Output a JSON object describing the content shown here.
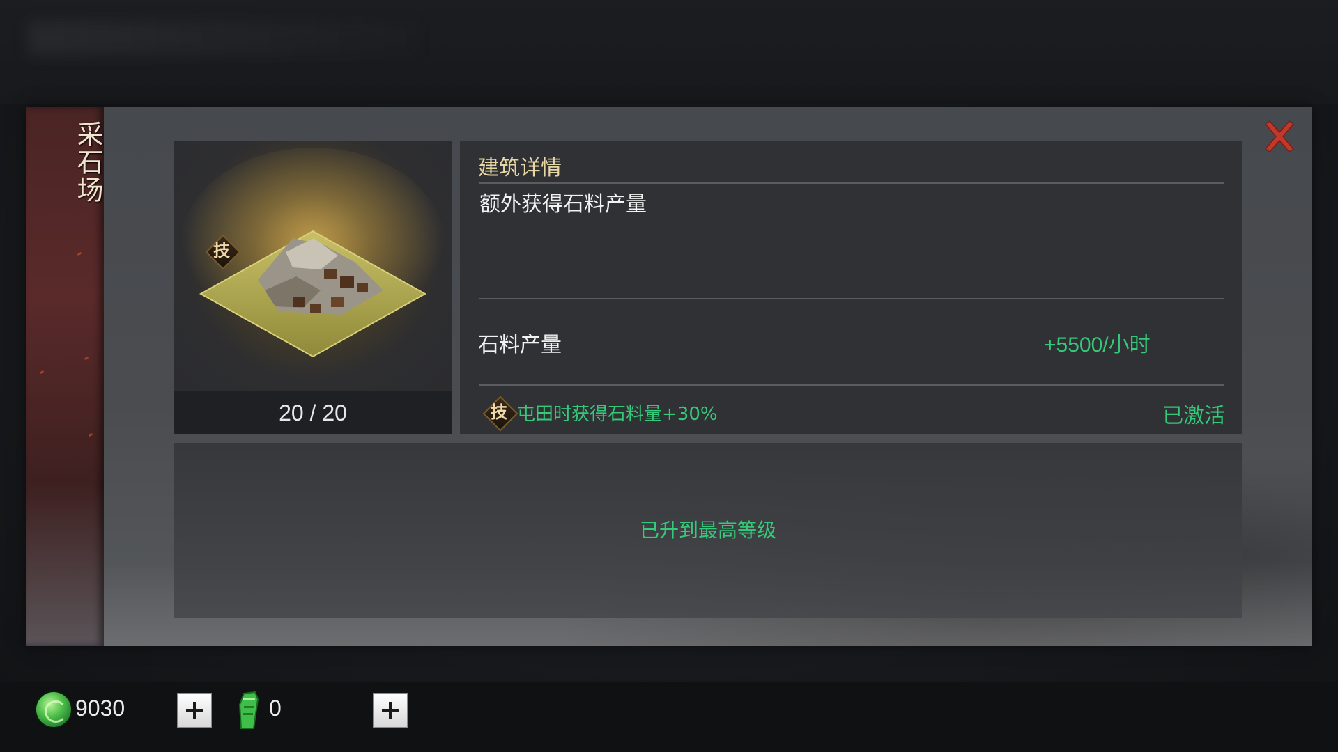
{
  "building": {
    "name": "采石场",
    "level_text": "20 / 20"
  },
  "detail": {
    "title": "建筑详情",
    "description": "额外获得石料产量",
    "stat_label": "石料产量",
    "stat_value": "+5500/小时",
    "tech_badge": "技",
    "tech_text": "屯田时获得石料量+30%",
    "tech_status": "已激活"
  },
  "upgrade": {
    "max_text": "已升到最高等级"
  },
  "resources": {
    "jade_value": "9030",
    "token_value": "0"
  },
  "colors": {
    "accent_green": "#35c97a",
    "title_gold": "#e8d7a6",
    "close_red": "#c0392b"
  },
  "icons": {
    "close": "close-x-icon",
    "jade": "jade-coin-icon",
    "token": "green-scroll-icon",
    "plus": "plus-icon"
  }
}
